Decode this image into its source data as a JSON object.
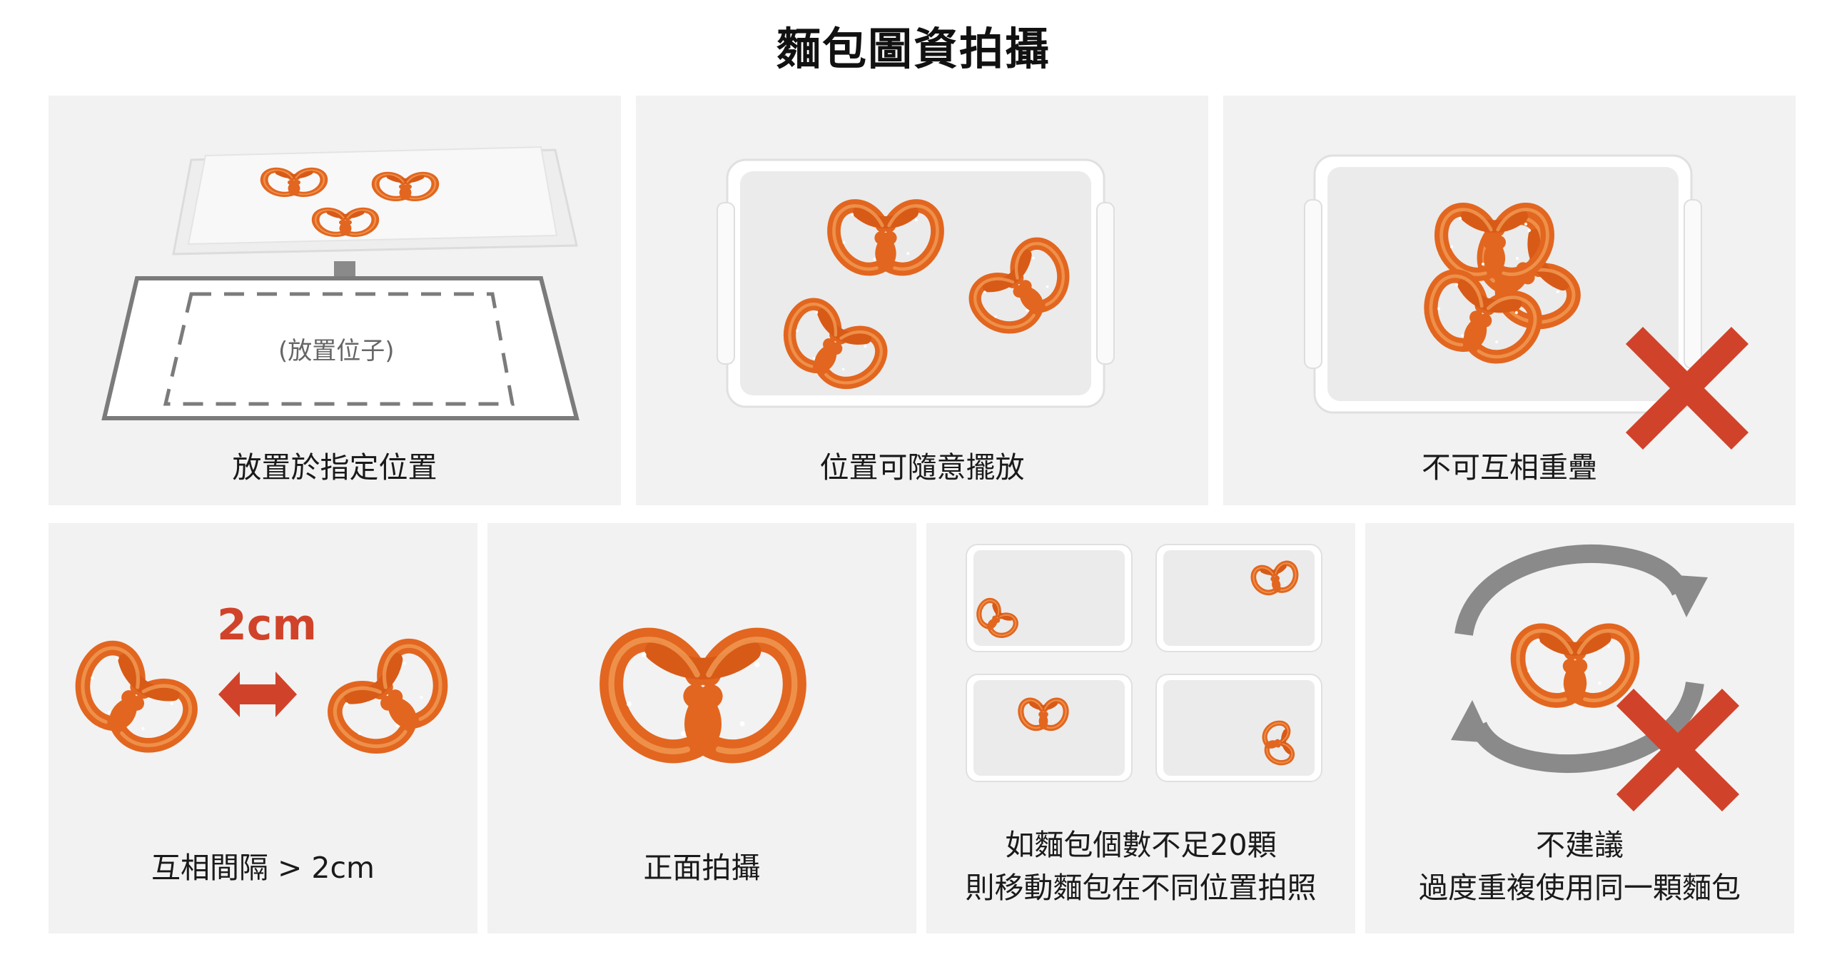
{
  "title": "麵包圖資拍攝",
  "panels": {
    "p1": {
      "caption": "放置於指定位置",
      "placeholder": "(放置位子)"
    },
    "p2": {
      "caption": "位置可隨意擺放"
    },
    "p3": {
      "caption": "不可互相重疊"
    },
    "p4": {
      "caption": "互相間隔 > 2cm",
      "distance": "2cm"
    },
    "p5": {
      "caption": "正面拍攝"
    },
    "p6": {
      "caption_line1": "如麵包個數不足20顆",
      "caption_line2": "則移動麵包在不同位置拍照"
    },
    "p7": {
      "caption_line1": "不建議",
      "caption_line2": "過度重複使用同一顆麵包"
    }
  },
  "colors": {
    "panel_bg": "#f2f2f2",
    "pretzel": "#e2661f",
    "pretzel_highlight": "#f3a25c",
    "cross": "#d0432a",
    "arrow_gray": "#8a8a8a"
  },
  "icons": [
    "pretzel-icon",
    "tray-icon",
    "down-arrow-icon",
    "double-arrow-icon",
    "cross-icon",
    "cycle-arrows-icon"
  ]
}
